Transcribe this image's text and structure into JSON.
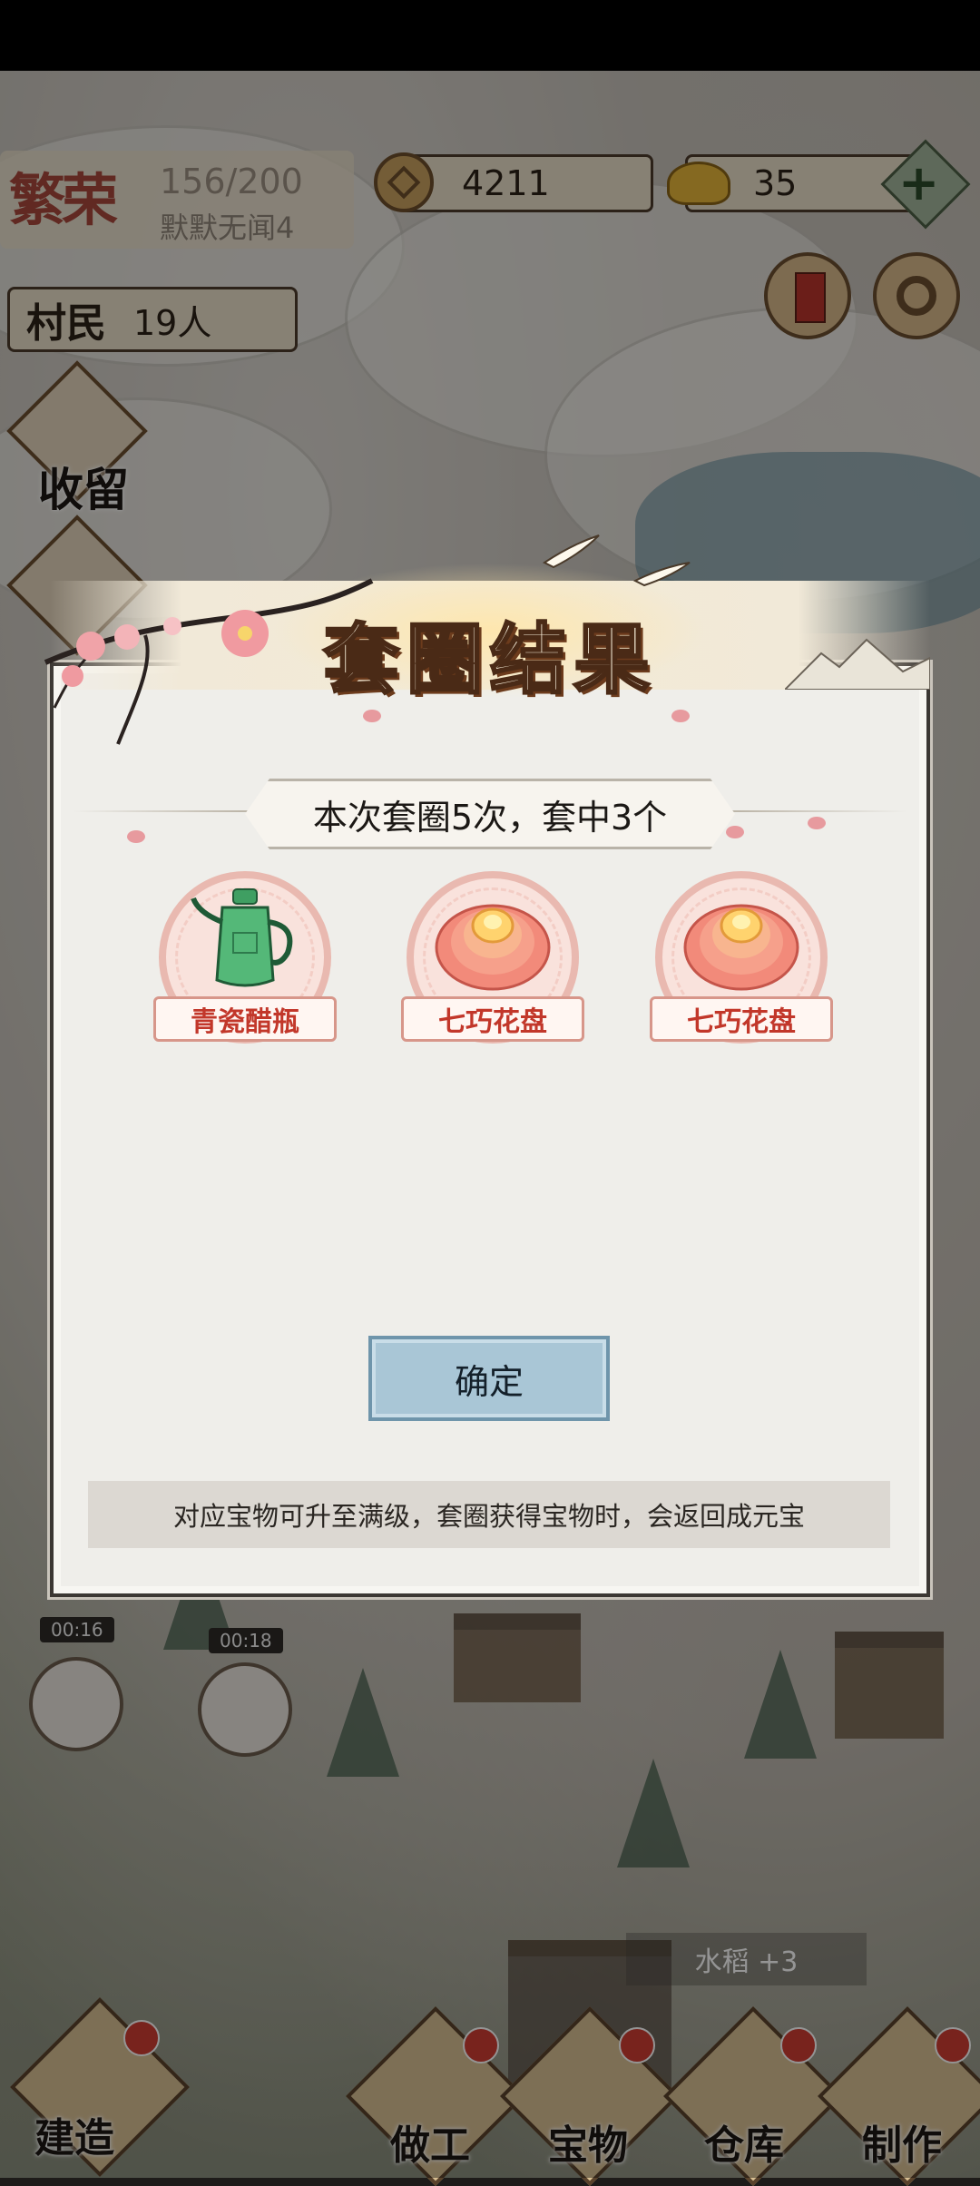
{
  "hud": {
    "fame_title": "繁荣",
    "fame_value": "156/200",
    "fame_sub": "默默无闻4",
    "coins": "4211",
    "ingots": "35",
    "villagers_label": "村民",
    "villagers_count": "19人"
  },
  "side_menu": {
    "shelter_label": "收留"
  },
  "timers": [
    "00:16",
    "00:18"
  ],
  "toast": "水稻 +3",
  "bottom_nav": [
    {
      "label": "建造"
    },
    {
      "label": "做工"
    },
    {
      "label": "宝物"
    },
    {
      "label": "仓库"
    },
    {
      "label": "制作"
    }
  ],
  "dialog": {
    "title": "套圈结果",
    "summary": "本次套圈5次，套中3个",
    "items": [
      {
        "name": "青瓷醋瓶",
        "icon": "celadon-vinegar-bottle-icon"
      },
      {
        "name": "七巧花盘",
        "icon": "flower-plate-icon"
      },
      {
        "name": "七巧花盘",
        "icon": "flower-plate-icon"
      }
    ],
    "confirm_label": "确定",
    "note": "对应宝物可升至满级，套圈获得宝物时，会返回成元宝"
  },
  "colors": {
    "title_fill": "#fbf3df",
    "title_stroke": "#4a2a16",
    "item_label_text": "#c2372a",
    "confirm_bg": "#a9c6d6",
    "notification_dot": "#cf3d33"
  }
}
